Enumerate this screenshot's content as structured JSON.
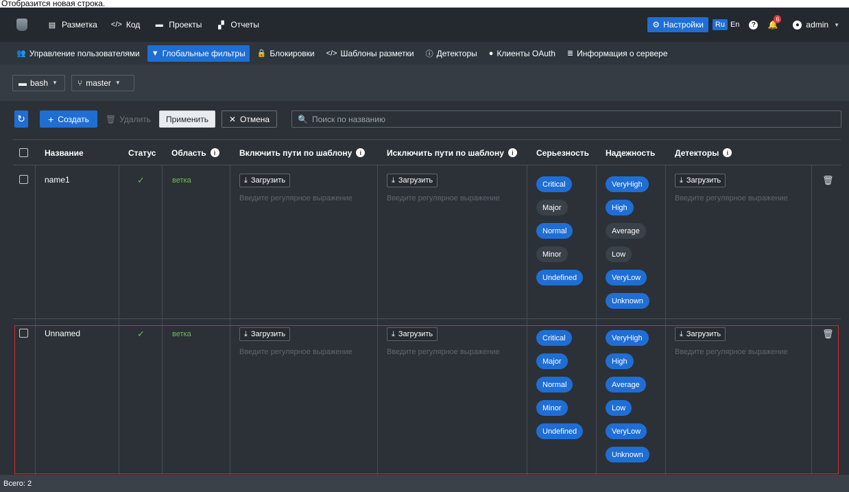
{
  "caption": "Отобразится новая строка.",
  "topbar": {
    "nav": [
      {
        "icon": "layout-icon",
        "glyph": "▤",
        "label": "Разметка"
      },
      {
        "icon": "code-icon",
        "glyph": "</>",
        "label": "Код"
      },
      {
        "icon": "projects-icon",
        "glyph": "▬",
        "label": "Проекты"
      },
      {
        "icon": "reports-icon",
        "glyph": "▞",
        "label": "Отчеты"
      }
    ],
    "settings_label": "Настройки",
    "lang_ru": "Ru",
    "lang_en": "En",
    "notifications_count": "6",
    "user": "admin"
  },
  "subnav": {
    "items": [
      {
        "icon": "users-icon",
        "glyph": "👥",
        "label": "Управление пользователями"
      },
      {
        "icon": "filter-icon",
        "glyph": "▼",
        "label": "Глобальные фильтры"
      },
      {
        "icon": "lock-icon",
        "glyph": "🔒",
        "label": "Блокировки"
      },
      {
        "icon": "code-icon",
        "glyph": "</>",
        "label": "Шаблоны разметки"
      },
      {
        "icon": "detector-icon",
        "glyph": "ⓘ",
        "label": "Детекторы"
      },
      {
        "icon": "client-icon",
        "glyph": "●",
        "label": "Клиенты OAuth"
      },
      {
        "icon": "server-icon",
        "glyph": "≣",
        "label": "Информация о сервере"
      }
    ],
    "active_index": 1
  },
  "branchbar": {
    "repo": "bash",
    "branch": "master"
  },
  "toolbar": {
    "create": "Создать",
    "delete": "Удалить",
    "apply": "Применить",
    "cancel": "Отмена",
    "search_placeholder": "Поиск по названию"
  },
  "table": {
    "columns": {
      "name": "Название",
      "status": "Статус",
      "scope": "Область",
      "include": "Включить пути по шаблону",
      "exclude": "Исключить пути по шаблону",
      "severity": "Серьезность",
      "reliability": "Надежность",
      "detectors": "Детекторы"
    },
    "upload_label": "Загрузить",
    "regex_placeholder": "Введите регулярное выражение",
    "rows": [
      {
        "name": "name1",
        "status": "✓",
        "scope": "ветка",
        "severity": [
          {
            "label": "Critical",
            "on": true
          },
          {
            "label": "Major",
            "on": false
          },
          {
            "label": "Normal",
            "on": true
          },
          {
            "label": "Minor",
            "on": false
          },
          {
            "label": "Undefined",
            "on": true
          }
        ],
        "reliability": [
          {
            "label": "VeryHigh",
            "on": true
          },
          {
            "label": "High",
            "on": true
          },
          {
            "label": "Average",
            "on": false
          },
          {
            "label": "Low",
            "on": false
          },
          {
            "label": "VeryLow",
            "on": true
          },
          {
            "label": "Unknown",
            "on": true
          }
        ]
      },
      {
        "name": "Unnamed",
        "status": "✓",
        "scope": "ветка",
        "severity": [
          {
            "label": "Critical",
            "on": true
          },
          {
            "label": "Major",
            "on": true
          },
          {
            "label": "Normal",
            "on": true
          },
          {
            "label": "Minor",
            "on": true
          },
          {
            "label": "Undefined",
            "on": true
          }
        ],
        "reliability": [
          {
            "label": "VeryHigh",
            "on": true
          },
          {
            "label": "High",
            "on": true
          },
          {
            "label": "Average",
            "on": true
          },
          {
            "label": "Low",
            "on": true
          },
          {
            "label": "VeryLow",
            "on": true
          },
          {
            "label": "Unknown",
            "on": true
          }
        ]
      }
    ]
  },
  "footer": {
    "total": "Всего: 2"
  },
  "colors": {
    "accent": "#1f6ed4",
    "selection": "#d22a2f",
    "success": "#6fbf4e"
  }
}
